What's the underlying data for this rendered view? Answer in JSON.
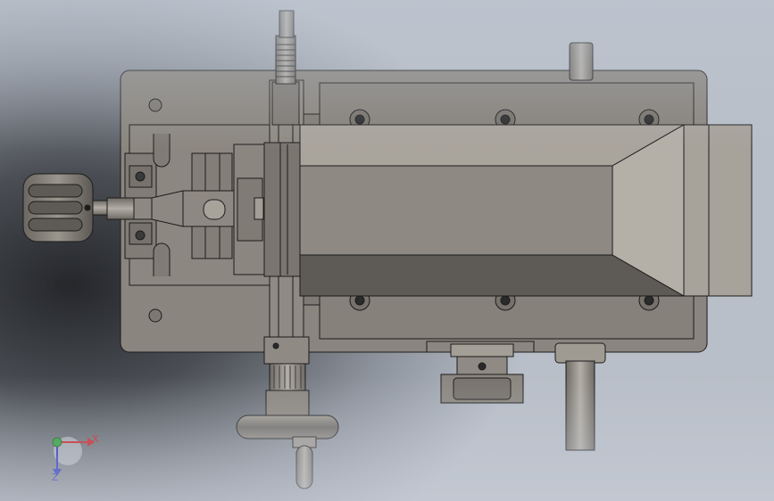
{
  "view": {
    "type": "3D CAD model view",
    "orientation": "top view"
  },
  "colors": {
    "body": "#8a857e",
    "body_dark": "#6b6761",
    "body_light": "#a9a49c",
    "edge": "#1c1c1c",
    "axis_x": "#c8151b",
    "axis_y": "#1f9a2c",
    "axis_z": "#1420c0"
  },
  "triad": {
    "x_label": "X",
    "z_label": "Z"
  }
}
